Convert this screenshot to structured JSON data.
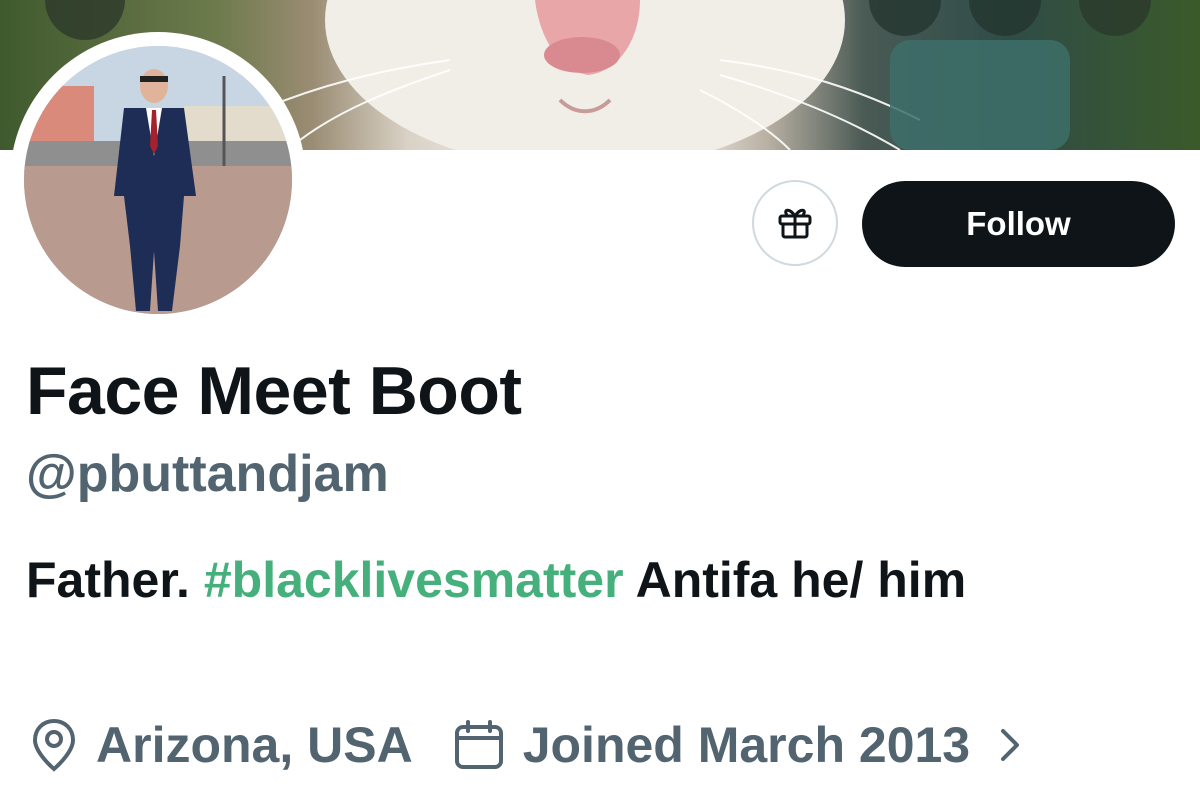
{
  "profile": {
    "display_name": "Face Meet Boot",
    "handle": "@pbuttandjam",
    "bio": {
      "part1": "Father. ",
      "hashtag": "#blacklivesmatter",
      "part2": " Antifa he/ him"
    },
    "location": "Arizona, USA",
    "joined": "Joined March 2013"
  },
  "actions": {
    "follow_label": "Follow"
  },
  "icons": {
    "gift": "gift-icon",
    "location": "location-pin-icon",
    "calendar": "calendar-icon",
    "chevron": "chevron-right-icon"
  },
  "colors": {
    "text_primary": "#0f1419",
    "text_secondary": "#536471",
    "hashtag": "#45b07c",
    "button_dark": "#0f1419"
  }
}
